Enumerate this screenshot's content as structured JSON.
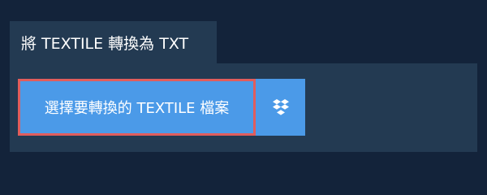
{
  "tab": {
    "title": "將 TEXTILE 轉換為 TXT"
  },
  "upload": {
    "choose_file_label": "選擇要轉換的 TEXTILE 檔案",
    "dropbox_icon": "dropbox-icon"
  },
  "colors": {
    "page_background": "#13233a",
    "panel_background": "#233a52",
    "button_background": "#4b9ae8",
    "focus_outline": "#e15d5c",
    "text": "#ffffff"
  }
}
